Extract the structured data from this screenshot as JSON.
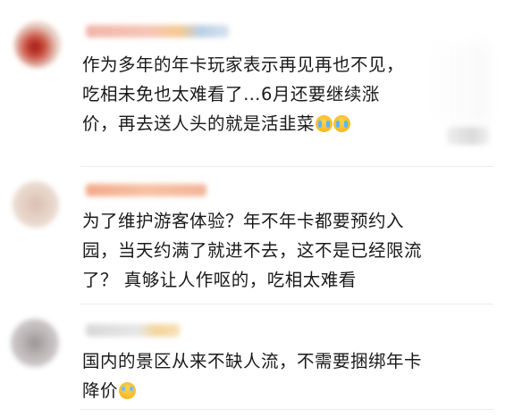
{
  "comments": [
    {
      "lines": [
        "作为多年的年卡玩家表示再见再也不见，",
        "吃相未免也太难看了…6月还要继续涨",
        "价，再去送人头的就是活韭菜"
      ],
      "emojis": [
        "crying-face-icon",
        "crying-face-icon"
      ]
    },
    {
      "lines": [
        "为了维护游客体验？年不年卡都要预约入",
        "园，当天约满了就进不去，这不是已经限流",
        "了？ 真够让人作呕的，吃相太难看"
      ]
    },
    {
      "lines": [
        "国内的景区从来不缺人流，不需要捆绑年卡",
        "降价"
      ],
      "emojis": [
        "laugh-cry-face-icon"
      ]
    }
  ],
  "colors": {
    "text": "#1a1a1a",
    "divider": "#ececec",
    "background": "#ffffff"
  }
}
